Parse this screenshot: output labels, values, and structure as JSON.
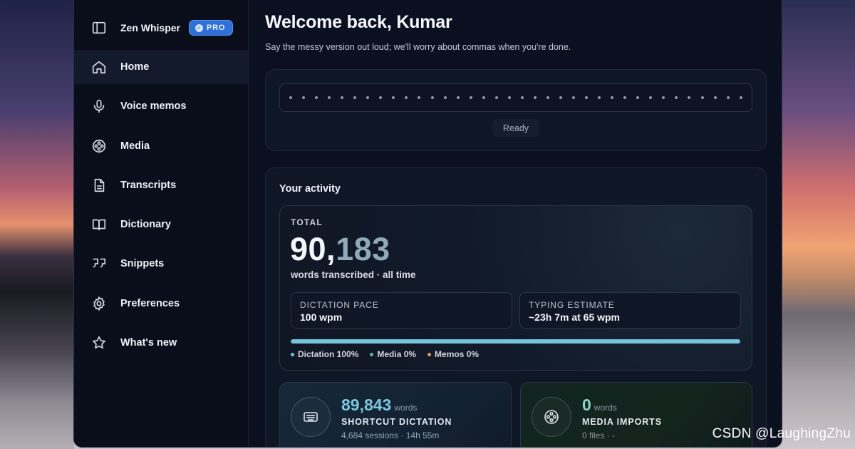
{
  "brand": {
    "name": "Zen Whisper",
    "badge": "PRO"
  },
  "sidebar": {
    "items": [
      {
        "label": "Home",
        "icon": "home-icon",
        "active": true
      },
      {
        "label": "Voice memos",
        "icon": "microphone-icon"
      },
      {
        "label": "Media",
        "icon": "film-reel-icon"
      },
      {
        "label": "Transcripts",
        "icon": "document-icon"
      },
      {
        "label": "Dictionary",
        "icon": "book-icon"
      },
      {
        "label": "Snippets",
        "icon": "quote-icon"
      },
      {
        "label": "Preferences",
        "icon": "gear-icon"
      },
      {
        "label": "What's new",
        "icon": "star-icon"
      }
    ]
  },
  "header": {
    "title": "Welcome back, Kumar",
    "subtitle": "Say the messy version out loud; we'll worry about commas when you're done."
  },
  "recorder": {
    "status": "Ready"
  },
  "activity": {
    "title": "Your activity",
    "total": {
      "label": "TOTAL",
      "value_head": "90,",
      "value_tail": "183",
      "caption": "words transcribed · all time"
    },
    "stats": [
      {
        "key": "DICTATION PACE",
        "value": "100 wpm"
      },
      {
        "key": "TYPING ESTIMATE",
        "value": "~23h 7m at 65 wpm"
      }
    ],
    "progress": {
      "dictation_fraction": 1.0
    },
    "legend": [
      {
        "label": "Dictation 100%",
        "color": "#76c3dc"
      },
      {
        "label": "Media 0%",
        "color": "#5fb8a8"
      },
      {
        "label": "Memos 0%",
        "color": "#d99a5a"
      }
    ],
    "cards": [
      {
        "value": "89,843",
        "unit": "words",
        "caption": "SHORTCUT DICTATION",
        "meta": "4,684 sessions · 14h 55m",
        "icon": "keyboard-icon"
      },
      {
        "value": "0",
        "unit": "words",
        "caption": "MEDIA IMPORTS",
        "meta": "0 files · -",
        "icon": "film-reel-icon"
      }
    ]
  },
  "watermark": "CSDN @LaughingZhu"
}
